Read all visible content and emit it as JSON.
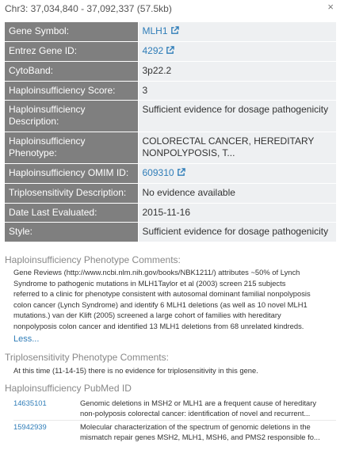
{
  "header": {
    "title": "Chr3: 37,034,840 - 37,092,337 (57.5kb)",
    "close_label": "×"
  },
  "info_rows": [
    {
      "label": "Gene Symbol:",
      "value": "MLH1",
      "link": true
    },
    {
      "label": "Entrez Gene ID:",
      "value": "4292",
      "link": true
    },
    {
      "label": "CytoBand:",
      "value": "3p22.2"
    },
    {
      "label": "Haploinsufficiency Score:",
      "value": "3"
    },
    {
      "label": "Haploinsufficiency Description:",
      "value": "Sufficient evidence for dosage pathogenicity"
    },
    {
      "label": "Haploinsufficiency Phenotype:",
      "value": "COLORECTAL CANCER, HEREDITARY NONPOLYPOSIS, T..."
    },
    {
      "label": "Haploinsufficiency OMIM ID:",
      "value": "609310",
      "link": true
    },
    {
      "label": "Triplosensitivity Description:",
      "value": "No evidence available"
    },
    {
      "label": "Date Last Evaluated:",
      "value": "2015-11-16"
    },
    {
      "label": "Style:",
      "value": "Sufficient evidence for dosage pathogenicity"
    }
  ],
  "hi_comments": {
    "title": "Haploinsufficiency Phenotype Comments:",
    "lines": [
      "Gene Reviews (http://www.ncbi.nlm.nih.gov/books/NBK1211/) attributes ~50% of Lynch",
      "Syndrome to pathogenic mutations in MLH1Taylor et al (2003) screen 215 subjects",
      "referred to a clinic for phenotype consistent with autosomal dominant familial nonpolyposis",
      "colon cancer (Lynch Syndrome) and identify 6 MLH1 deletions (as well as 10 novel MLH1",
      "mutations.) van der Klift (2005) screened a large cohort of families with hereditary",
      "nonpolyposis colon cancer and identified 13 MLH1 deletions from 68 unrelated kindreds."
    ],
    "less_label": "Less..."
  },
  "ts_comments": {
    "title": "Triplosensitivity Phenotype Comments:",
    "text": "At this time (11-14-15) there is no evidence for triplosensitivity in this gene."
  },
  "pubmed": {
    "title": "Haploinsufficiency PubMed ID",
    "rows": [
      {
        "id": "14635101",
        "line1": "Genomic deletions in MSH2 or MLH1 are a frequent cause of hereditary",
        "line2": "non-polyposis colorectal cancer: identification of novel and recurrent..."
      },
      {
        "id": "15942939",
        "line1": "Molecular characterization of the spectrum of genomic deletions in the",
        "line2": "mismatch repair genes MSH2, MLH1, MSH6, and PMS2 responsible fo..."
      }
    ]
  }
}
